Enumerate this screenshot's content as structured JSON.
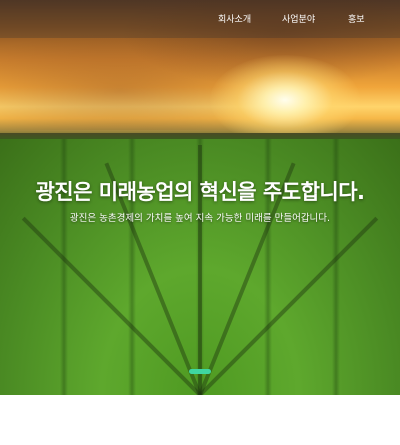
{
  "nav": {
    "items": [
      {
        "label": "회사소개"
      },
      {
        "label": "사업분야"
      },
      {
        "label": "홍보"
      }
    ]
  },
  "hero": {
    "headline": "광진은 미래농업의 혁신을 주도합니다.",
    "subline": "광진은 농촌경제의 가치를 높여 지속 가능한 미래를 만들어갑니다.",
    "slide_index": 1
  },
  "colors": {
    "pager_accent": "#3fd6a0",
    "page_background": "#ffffff"
  }
}
